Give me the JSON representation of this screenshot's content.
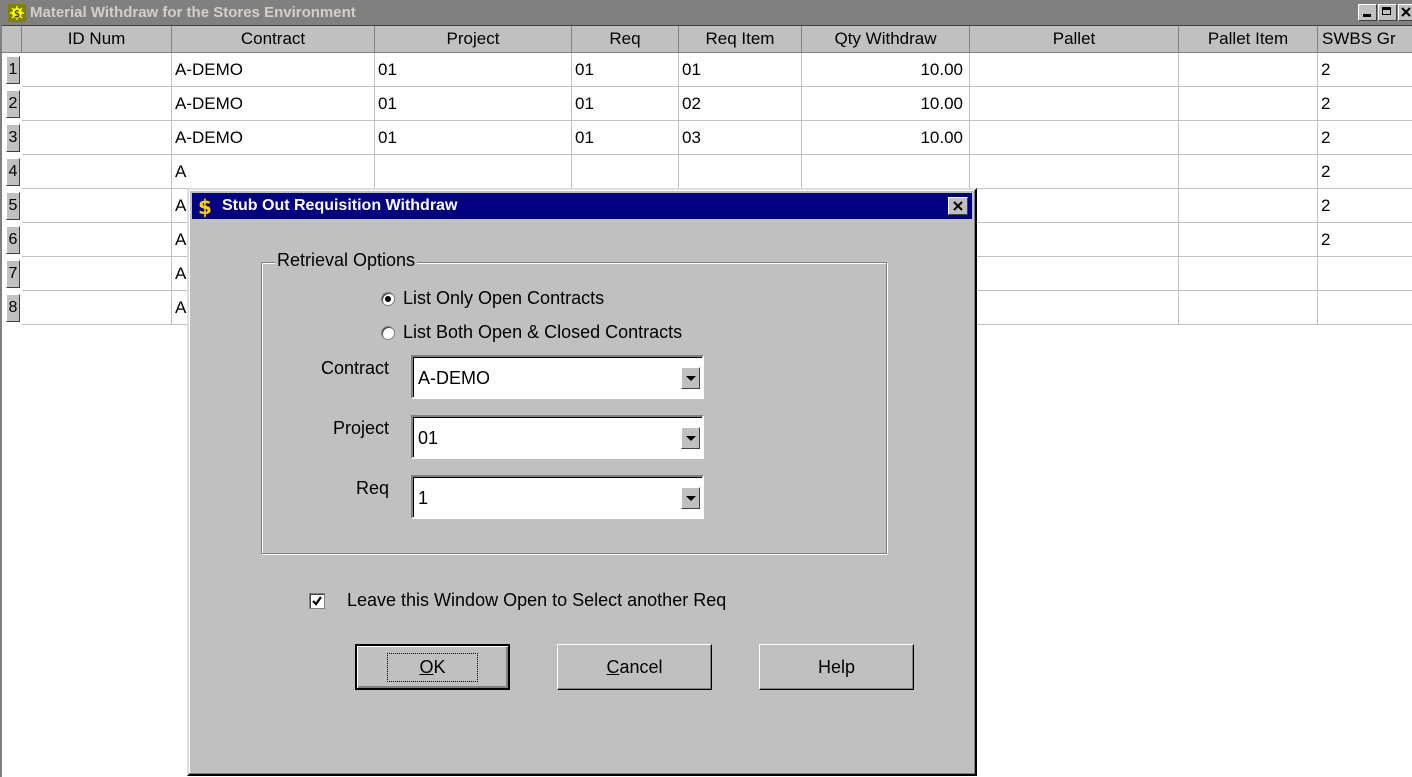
{
  "window": {
    "title": "Material Withdraw for the Stores Environment",
    "controls": {
      "minimize": "minimize",
      "maximize": "maximize",
      "close": "close"
    }
  },
  "grid": {
    "columns": [
      "ID Num",
      "Contract",
      "Project",
      "Req",
      "Req Item",
      "Qty Withdraw",
      "Pallet",
      "Pallet Item",
      "SWBS Gr"
    ],
    "rows": [
      {
        "row": "1",
        "id": "",
        "contract": "A-DEMO",
        "project": "01",
        "req": "01",
        "req_item": "01",
        "qty": "10.00",
        "pallet": "",
        "pallet_item": "",
        "swbs": "2"
      },
      {
        "row": "2",
        "id": "",
        "contract": "A-DEMO",
        "project": "01",
        "req": "01",
        "req_item": "02",
        "qty": "10.00",
        "pallet": "",
        "pallet_item": "",
        "swbs": "2"
      },
      {
        "row": "3",
        "id": "",
        "contract": "A-DEMO",
        "project": "01",
        "req": "01",
        "req_item": "03",
        "qty": "10.00",
        "pallet": "",
        "pallet_item": "",
        "swbs": "2"
      },
      {
        "row": "4",
        "id": "",
        "contract": "A",
        "project": "",
        "req": "",
        "req_item": "",
        "qty": "",
        "pallet": "",
        "pallet_item": "",
        "swbs": "2"
      },
      {
        "row": "5",
        "id": "",
        "contract": "A",
        "project": "",
        "req": "",
        "req_item": "",
        "qty": "",
        "pallet": "",
        "pallet_item": "",
        "swbs": "2"
      },
      {
        "row": "6",
        "id": "",
        "contract": "A",
        "project": "",
        "req": "",
        "req_item": "",
        "qty": "",
        "pallet": "",
        "pallet_item": "",
        "swbs": "2"
      },
      {
        "row": "7",
        "id": "",
        "contract": "A",
        "project": "",
        "req": "",
        "req_item": "",
        "qty": "",
        "pallet": "",
        "pallet_item": "",
        "swbs": ""
      },
      {
        "row": "8",
        "id": "",
        "contract": "A",
        "project": "",
        "req": "",
        "req_item": "",
        "qty": "",
        "pallet": "",
        "pallet_item": "",
        "swbs": ""
      }
    ]
  },
  "dialog": {
    "title": "Stub Out Requisition Withdraw",
    "icon": "dollar-icon",
    "group_label": "Retrieval Options",
    "radio_open": "List Only Open Contracts",
    "radio_both": "List Both Open & Closed Contracts",
    "radio_selected": "open",
    "contract_label": "Contract",
    "contract_value": "A-DEMO",
    "project_label": "Project",
    "project_value": "01",
    "req_label": "Req",
    "req_value": "1",
    "leave_open_label": "Leave this Window Open to Select another Req",
    "leave_open_checked": true,
    "ok_label": "OK",
    "ok_mnemonic": "O",
    "ok_rest": "K",
    "cancel_label": "Cancel",
    "cancel_mnemonic": "C",
    "cancel_rest": "ancel",
    "help_label": "Help"
  },
  "colors": {
    "dialog_title_bg": "#000080",
    "inactive_title_bg": "#808080",
    "face": "#c0c0c0"
  }
}
